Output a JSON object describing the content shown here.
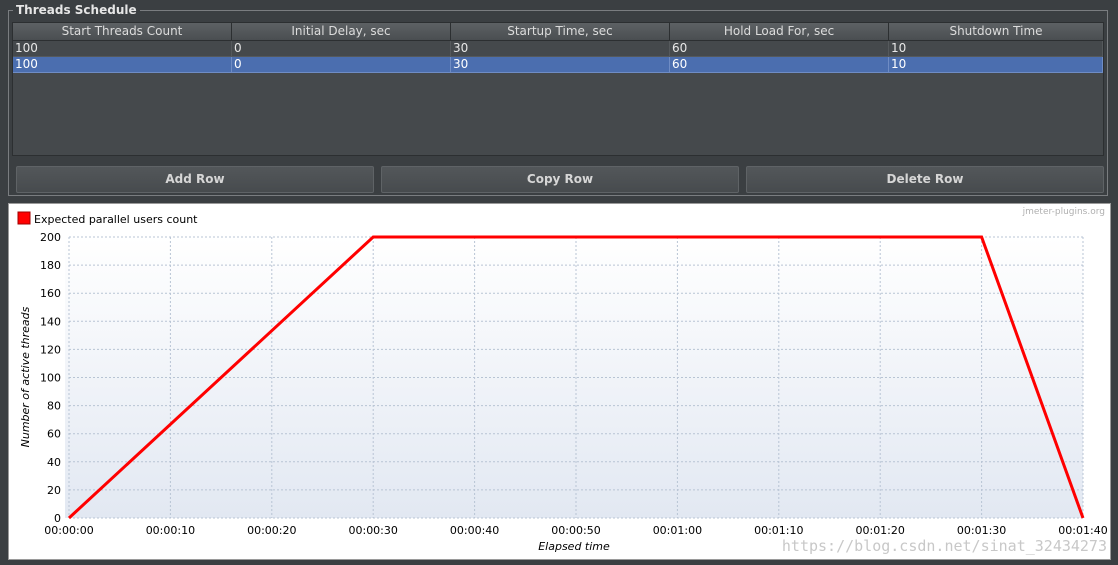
{
  "threads_schedule": {
    "title": "Threads Schedule",
    "columns": [
      "Start Threads Count",
      "Initial Delay, sec",
      "Startup Time, sec",
      "Hold Load For, sec",
      "Shutdown Time"
    ],
    "rows": [
      [
        "100",
        "0",
        "30",
        "60",
        "10"
      ],
      [
        "100",
        "0",
        "30",
        "60",
        "10"
      ]
    ],
    "selected_row": 1,
    "buttons": {
      "add": "Add Row",
      "copy": "Copy Row",
      "delete": "Delete Row"
    }
  },
  "chart": {
    "watermark": "jmeter-plugins.org",
    "footer_watermark": "https://blog.csdn.net/sinat_32434273",
    "colors": {
      "series": "#ff0000",
      "grid": "#b8c4d4"
    }
  },
  "chart_data": {
    "type": "line",
    "legend": "Expected parallel users count",
    "legend_position": "top-left",
    "xlabel": "Elapsed time",
    "ylabel": "Number of active threads",
    "x_ticks": [
      "00:00:00",
      "00:00:10",
      "00:00:20",
      "00:00:30",
      "00:00:40",
      "00:00:50",
      "00:01:00",
      "00:01:10",
      "00:01:20",
      "00:01:30",
      "00:01:40"
    ],
    "y_ticks": [
      "0",
      "20",
      "40",
      "60",
      "80",
      "100",
      "120",
      "140",
      "160",
      "180",
      "200"
    ],
    "xlim": [
      0,
      100
    ],
    "ylim": [
      0,
      200
    ],
    "grid": true,
    "series": [
      {
        "name": "Expected parallel users count",
        "color": "#ff0000",
        "x": [
          0,
          30,
          90,
          100
        ],
        "y": [
          0,
          200,
          200,
          0
        ]
      }
    ]
  }
}
